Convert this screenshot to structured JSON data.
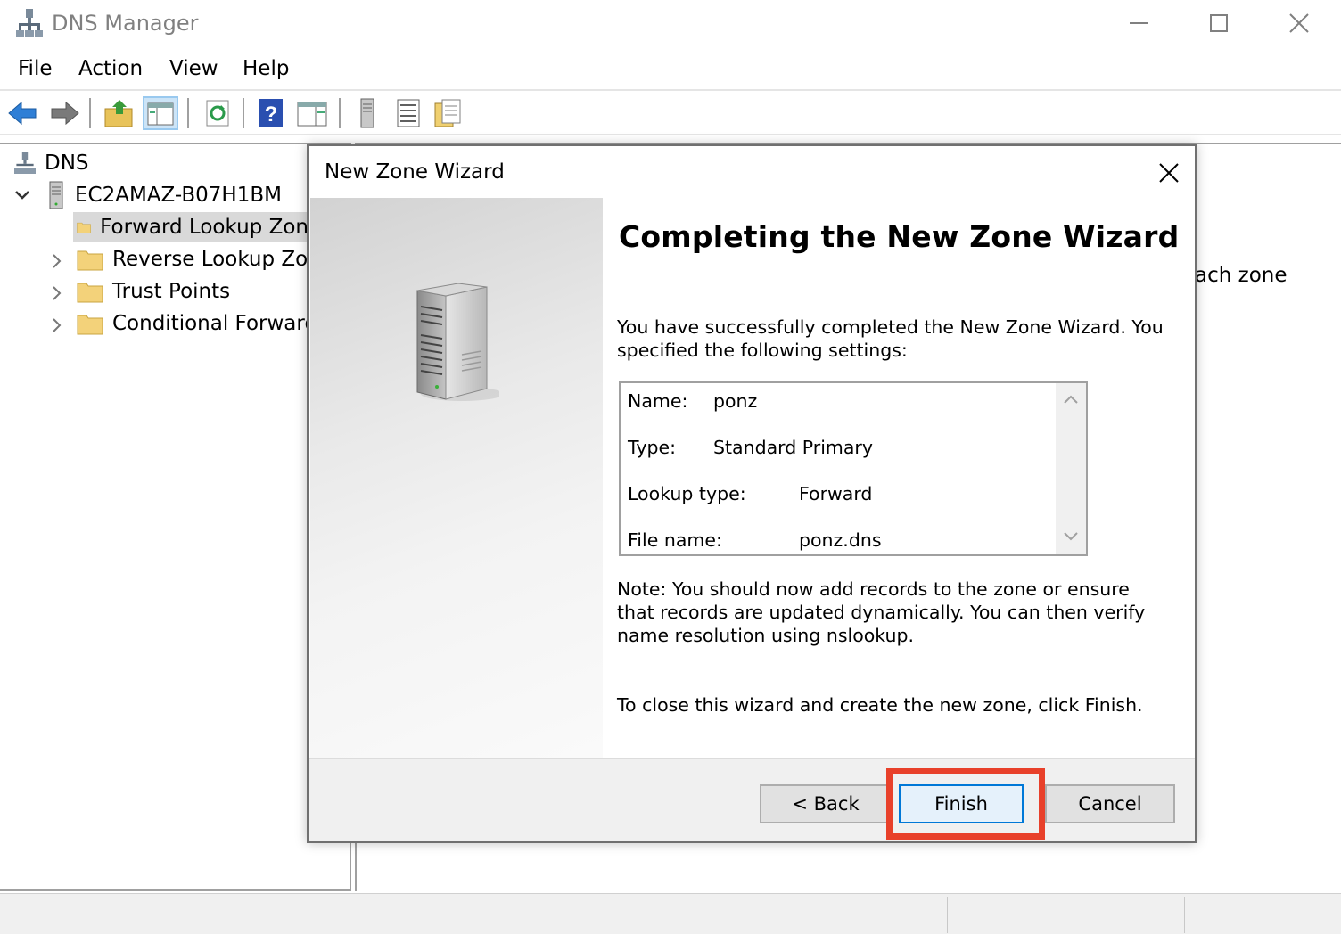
{
  "window": {
    "title": "DNS Manager"
  },
  "menu": {
    "file": "File",
    "action": "Action",
    "view": "View",
    "help": "Help"
  },
  "toolbar": {
    "icons": [
      "back-arrow-icon",
      "forward-arrow-icon",
      "folder-up-icon",
      "show-hide-console-tree-icon",
      "refresh-icon",
      "help-icon",
      "action-pane-icon",
      "server-icon",
      "list-icon",
      "properties-icon"
    ]
  },
  "tree": {
    "root": "DNS",
    "server": "EC2AMAZ-B07H1BM",
    "items": [
      {
        "label": "Forward Lookup Zon"
      },
      {
        "label": "Reverse Lookup Zon"
      },
      {
        "label": "Trust Points"
      },
      {
        "label": "Conditional Forward"
      }
    ]
  },
  "right_pane": {
    "partial_text": "ach zone"
  },
  "dialog": {
    "title": "New Zone Wizard",
    "heading": "Completing the New Zone Wizard",
    "intro": "You have successfully completed the New Zone Wizard. You specified the following settings:",
    "settings": [
      {
        "label": "Name:",
        "value": "ponz"
      },
      {
        "label": "Type:",
        "value": "Standard Primary"
      },
      {
        "label": "Lookup type:",
        "value": "Forward"
      },
      {
        "label": "File name:",
        "value": "ponz.dns"
      }
    ],
    "note": "Note: You should now add records to the zone or ensure that records are updated dynamically. You can then verify name resolution using nslookup.",
    "finish_text": "To close this wizard and create the new zone, click Finish.",
    "buttons": {
      "back": "< Back",
      "finish": "Finish",
      "cancel": "Cancel"
    }
  },
  "colors": {
    "highlight": "#e8402a",
    "selection": "#d9d9d9",
    "focus_border": "#0078d7"
  }
}
